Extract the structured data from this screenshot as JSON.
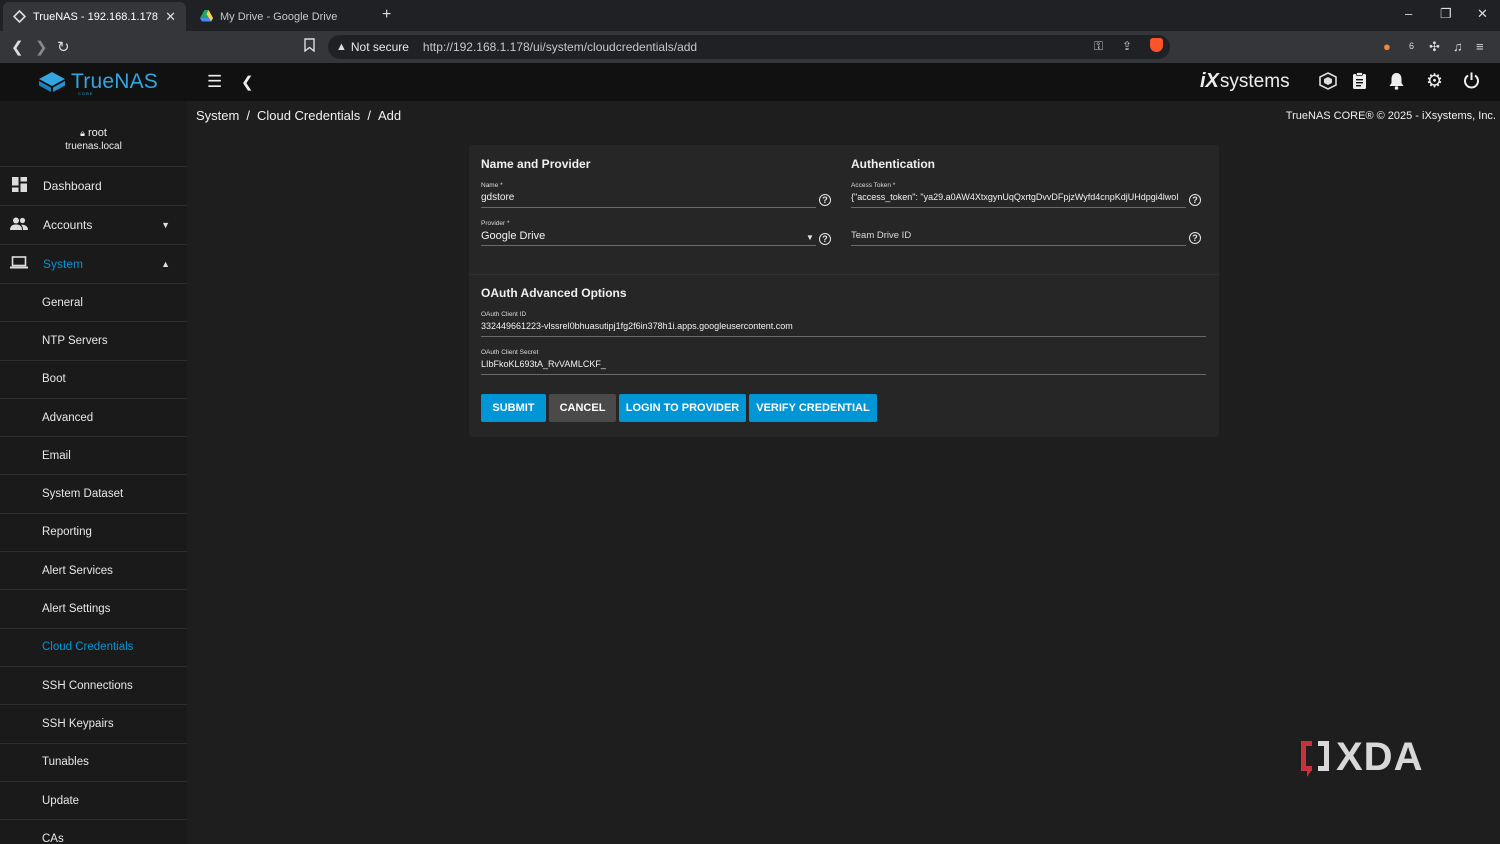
{
  "browser": {
    "tabs": [
      {
        "title": "TrueNAS - 192.168.1.178",
        "active": true
      },
      {
        "title": "My Drive - Google Drive",
        "active": false
      }
    ],
    "security_label": "Not secure",
    "url": "http://192.168.1.178/ui/system/cloudcredentials/add"
  },
  "app": {
    "brand": "TrueNAS",
    "brand_sub": "CORE",
    "vendor": "systems"
  },
  "user": {
    "name": "root",
    "host": "truenas.local"
  },
  "sidebar": {
    "items": [
      {
        "label": "Dashboard",
        "icon": "dashboard-icon"
      },
      {
        "label": "Accounts",
        "icon": "people-icon"
      },
      {
        "label": "System",
        "icon": "laptop-icon"
      }
    ],
    "system_subitems": [
      "General",
      "NTP Servers",
      "Boot",
      "Advanced",
      "Email",
      "System Dataset",
      "Reporting",
      "Alert Services",
      "Alert Settings",
      "Cloud Credentials",
      "SSH Connections",
      "SSH Keypairs",
      "Tunables",
      "Update",
      "CAs"
    ],
    "active_subitem": "Cloud Credentials"
  },
  "breadcrumb": [
    "System",
    "Cloud Credentials",
    "Add"
  ],
  "copyright": "TrueNAS CORE® © 2025 - iXsystems, Inc.",
  "form": {
    "name_provider_title": "Name and Provider",
    "authentication_title": "Authentication",
    "name": {
      "label": "Name *",
      "value": "gdstore"
    },
    "provider": {
      "label": "Provider *",
      "value": "Google Drive"
    },
    "access_token": {
      "label": "Access Token *",
      "value": "{\"access_token\": \"ya29.a0AW4XtxgynUqQxrtgDvvDFpjzWyfd4cnpKdjUHdpgi4lwol"
    },
    "team_drive": {
      "placeholder": "Team Drive ID"
    },
    "oauth_title": "OAuth Advanced Options",
    "oauth_client_id": {
      "label": "OAuth Client ID",
      "value": "332449661223-vlssrel0bhuasutipj1fg2f6in378h1i.apps.googleusercontent.com"
    },
    "oauth_client_secret": {
      "label": "OAuth Client Secret",
      "value": "LIbFkoKL693tA_RvVAMLCKF_"
    },
    "buttons": {
      "submit": "SUBMIT",
      "cancel": "CANCEL",
      "login": "LOGIN TO PROVIDER",
      "verify": "VERIFY CREDENTIAL"
    }
  },
  "watermark": "XDA",
  "colors": {
    "accent": "#0095d5",
    "header_bg": "#111111",
    "sidebar_bg": "#1a1a1a",
    "card_bg": "#262626",
    "page_bg": "#1e1e1e"
  }
}
